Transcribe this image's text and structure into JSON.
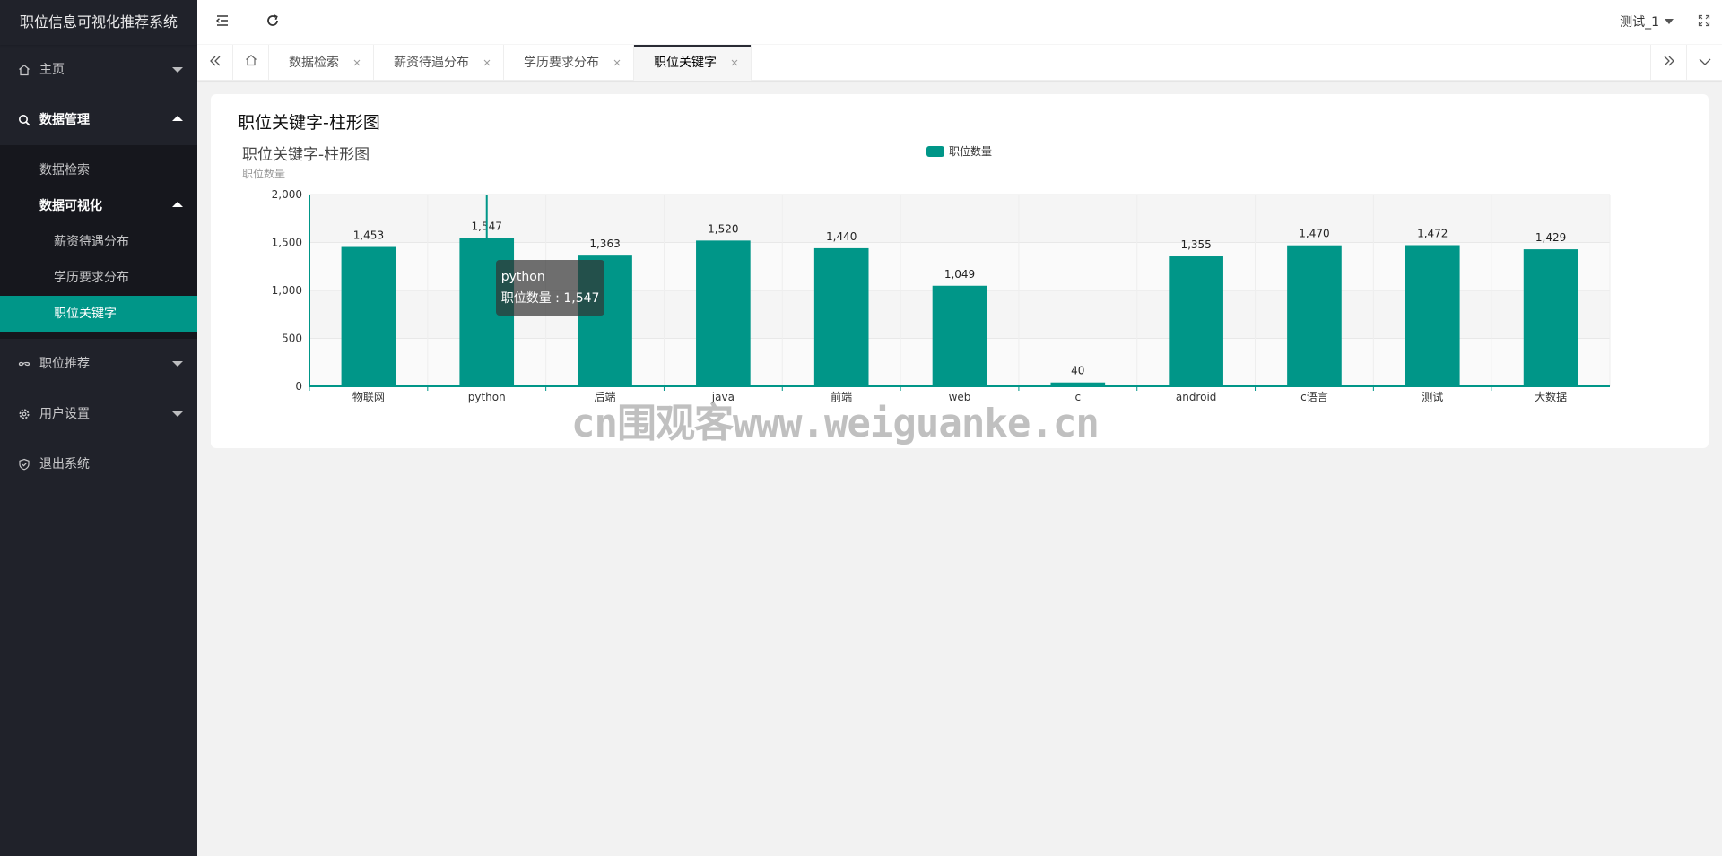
{
  "app": {
    "title": "职位信息可视化推荐系统"
  },
  "sidebar": {
    "items": [
      {
        "label": "主页",
        "icon": "home-icon"
      },
      {
        "label": "数据管理",
        "icon": "search-icon",
        "open": true,
        "children": [
          {
            "label": "数据检索"
          },
          {
            "label": "数据可视化",
            "open": true,
            "children": [
              {
                "label": "薪资待遇分布"
              },
              {
                "label": "学历要求分布"
              },
              {
                "label": "职位关键字",
                "active": true
              }
            ]
          }
        ]
      },
      {
        "label": "职位推荐",
        "icon": "link-icon"
      },
      {
        "label": "用户设置",
        "icon": "gear-icon"
      },
      {
        "label": "退出系统",
        "icon": "shield-icon"
      }
    ]
  },
  "header": {
    "user": "测试_1"
  },
  "tabs": [
    {
      "label": "数据检索"
    },
    {
      "label": "薪资待遇分布"
    },
    {
      "label": "学历要求分布"
    },
    {
      "label": "职位关键字",
      "active": true
    }
  ],
  "card": {
    "title": "职位关键字-柱形图"
  },
  "colors": {
    "accent": "#009688",
    "sidebar": "#20222a"
  },
  "chart_data": {
    "type": "bar",
    "title": "职位关键字-柱形图",
    "ylabel": "职位数量",
    "xlabel": "",
    "categories": [
      "物联网",
      "python",
      "后端",
      "java",
      "前端",
      "web",
      "c",
      "android",
      "c语言",
      "测试",
      "大数据"
    ],
    "series": [
      {
        "name": "职位数量",
        "values": [
          1453,
          1547,
          1363,
          1520,
          1440,
          1049,
          40,
          1355,
          1470,
          1472,
          1429
        ]
      }
    ],
    "ylim": [
      0,
      2000
    ],
    "yticks": [
      0,
      500,
      1000,
      1500,
      2000
    ],
    "legend": "top-center",
    "grid": true,
    "tooltip": {
      "category": "python",
      "series": "职位数量",
      "value": "1,547"
    }
  },
  "watermark": "cn围观客www.weiguanke.cn"
}
